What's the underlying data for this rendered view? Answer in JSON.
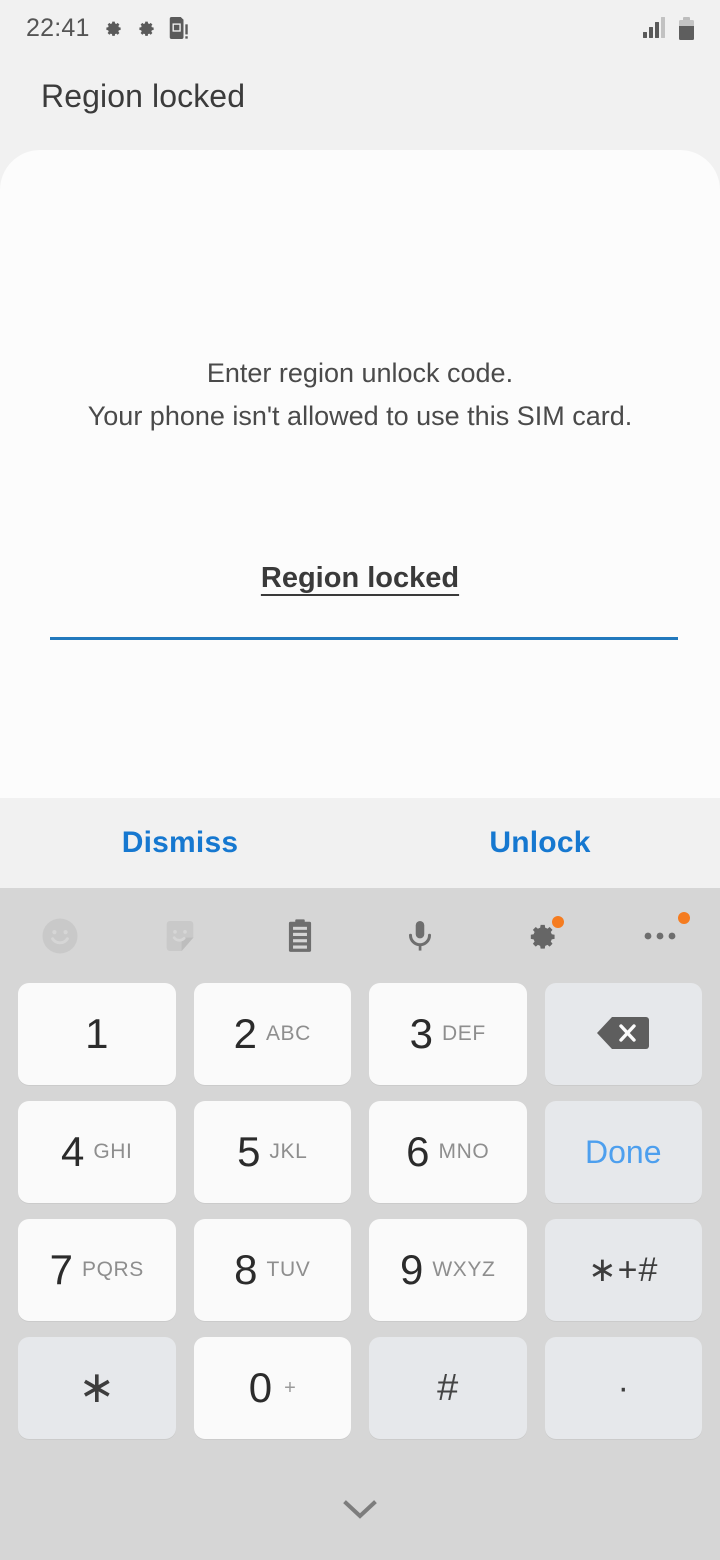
{
  "status_bar": {
    "time": "22:41",
    "icons": [
      "gear-icon",
      "gear-icon",
      "sim-card-alert-icon"
    ],
    "signal_bars": 3,
    "signal_bars_total": 4,
    "battery_level_pct": 70
  },
  "dialog": {
    "title": "Region locked",
    "message_line1": "Enter region unlock code.",
    "message_line2": "Your phone isn't allowed to use this SIM card.",
    "input_value": "",
    "input_placeholder": "",
    "link_label": "Region locked",
    "buttons": {
      "dismiss": "Dismiss",
      "unlock": "Unlock"
    }
  },
  "keyboard": {
    "toolbar": [
      {
        "name": "emoji-icon",
        "badge": false,
        "disabled": true
      },
      {
        "name": "sticker-icon",
        "badge": false,
        "disabled": true
      },
      {
        "name": "clipboard-icon",
        "badge": false,
        "disabled": false
      },
      {
        "name": "microphone-icon",
        "badge": false,
        "disabled": false
      },
      {
        "name": "gear-icon",
        "badge": true,
        "disabled": false
      },
      {
        "name": "more-options-icon",
        "badge": true,
        "disabled": false
      }
    ],
    "rows": [
      [
        {
          "digit": "1",
          "letters": ""
        },
        {
          "digit": "2",
          "letters": "ABC"
        },
        {
          "digit": "3",
          "letters": "DEF"
        },
        {
          "label": "",
          "icon": "backspace-icon",
          "fn": true
        }
      ],
      [
        {
          "digit": "4",
          "letters": "GHI"
        },
        {
          "digit": "5",
          "letters": "JKL"
        },
        {
          "digit": "6",
          "letters": "MNO"
        },
        {
          "label": "Done",
          "fn": true
        }
      ],
      [
        {
          "digit": "7",
          "letters": "PQRS"
        },
        {
          "digit": "8",
          "letters": "TUV"
        },
        {
          "digit": "9",
          "letters": "WXYZ"
        },
        {
          "label": "∗+#",
          "fn": true
        }
      ],
      [
        {
          "label": "∗",
          "fn": true
        },
        {
          "digit": "0",
          "letters": "+"
        },
        {
          "label": "#",
          "fn": true
        },
        {
          "label": "·",
          "fn": true
        }
      ]
    ],
    "hide_keyboard_icon": "chevron-down-icon"
  },
  "colors": {
    "accent_blue": "#1678d0",
    "input_underline": "#2279bd",
    "done_blue": "#4d9fee",
    "badge_orange": "#f57c20",
    "page_bg": "#f1f1f1",
    "card_bg": "#fcfcfc",
    "keyboard_bg": "#d6d6d6",
    "key_bg": "#fafafa",
    "fn_key_bg": "#e6e8eb"
  }
}
